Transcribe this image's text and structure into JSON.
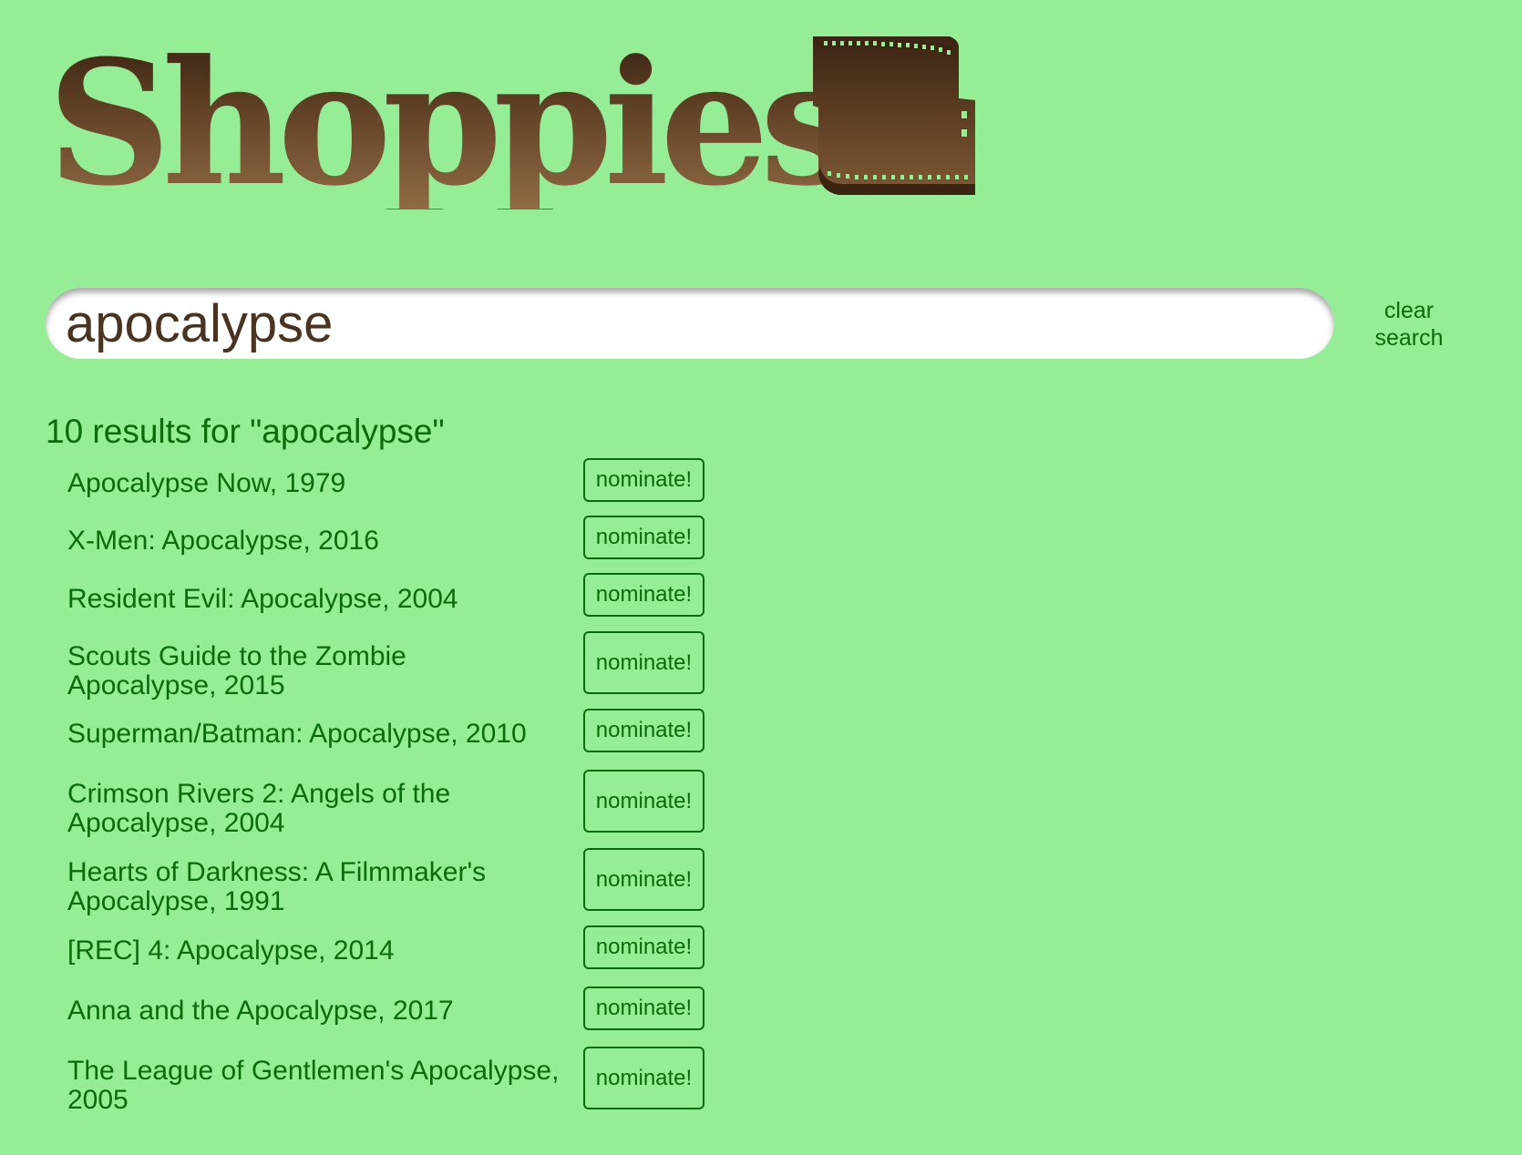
{
  "logo": {
    "text": "Shoppies",
    "icon": "film-strip-icon",
    "gradient_top": "#3b2412",
    "gradient_bottom": "#8f6b43"
  },
  "colors": {
    "background": "#95ee95",
    "text": "#0a6b0a",
    "search_text": "#4a3320"
  },
  "search": {
    "value": "apocalypse",
    "clear_label_line1": "clear",
    "clear_label_line2": "search"
  },
  "results": {
    "heading": "10 results for \"apocalypse\"",
    "items": [
      {
        "title": "Apocalypse Now, 1979",
        "button": "nominate!"
      },
      {
        "title": "X-Men: Apocalypse, 2016",
        "button": "nominate!"
      },
      {
        "title": "Resident Evil: Apocalypse, 2004",
        "button": "nominate!"
      },
      {
        "title": "Scouts Guide to the Zombie Apocalypse, 2015",
        "button": "nominate!"
      },
      {
        "title": "Superman/Batman: Apocalypse, 2010",
        "button": "nominate!"
      },
      {
        "title": "Crimson Rivers 2: Angels of the Apocalypse, 2004",
        "button": "nominate!"
      },
      {
        "title": "Hearts of Darkness: A Filmmaker's Apocalypse, 1991",
        "button": "nominate!"
      },
      {
        "title": "[REC] 4: Apocalypse, 2014",
        "button": "nominate!"
      },
      {
        "title": "Anna and the Apocalypse, 2017",
        "button": "nominate!"
      },
      {
        "title": "The League of Gentlemen's Apocalypse, 2005",
        "button": "nominate!"
      }
    ]
  }
}
